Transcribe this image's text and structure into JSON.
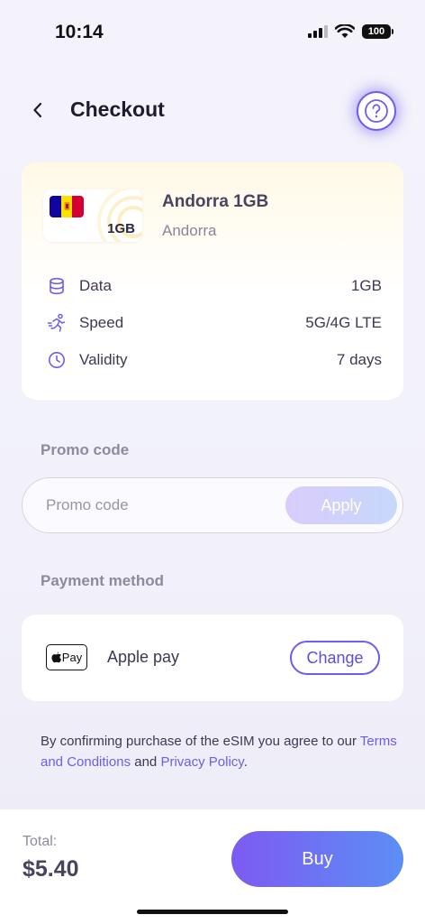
{
  "status_bar": {
    "time": "10:14",
    "battery": "100"
  },
  "header": {
    "title": "Checkout",
    "back_icon": "chevron-left-icon",
    "help_icon": "question-mark-icon"
  },
  "plan": {
    "sim_size": "1GB",
    "name": "Andorra 1GB",
    "country": "Andorra",
    "flag_colors": [
      "#10069f",
      "#fedf00",
      "#d50032"
    ],
    "specs": [
      {
        "icon": "database-icon",
        "label": "Data",
        "value": "1GB"
      },
      {
        "icon": "running-speed-icon",
        "label": "Speed",
        "value": "5G/4G LTE"
      },
      {
        "icon": "clock-icon",
        "label": "Validity",
        "value": "7 days"
      }
    ]
  },
  "promo": {
    "section_label": "Promo code",
    "placeholder": "Promo code",
    "value": "",
    "apply_label": "Apply"
  },
  "payment": {
    "section_label": "Payment method",
    "logo_text": "Pay",
    "method_name": "Apple pay",
    "change_label": "Change"
  },
  "legal": {
    "prefix": "By confirming purchase of the eSIM you agree to our ",
    "terms_link": "Terms and Conditions",
    "middle": " and ",
    "privacy_link": "Privacy Policy",
    "suffix": "."
  },
  "footer": {
    "total_label": "Total:",
    "total_value": "$5.40",
    "buy_label": "Buy"
  },
  "colors": {
    "accent": "#6b5df0",
    "buy_gradient_start": "#7d5af2",
    "buy_gradient_end": "#5c8ef5"
  }
}
